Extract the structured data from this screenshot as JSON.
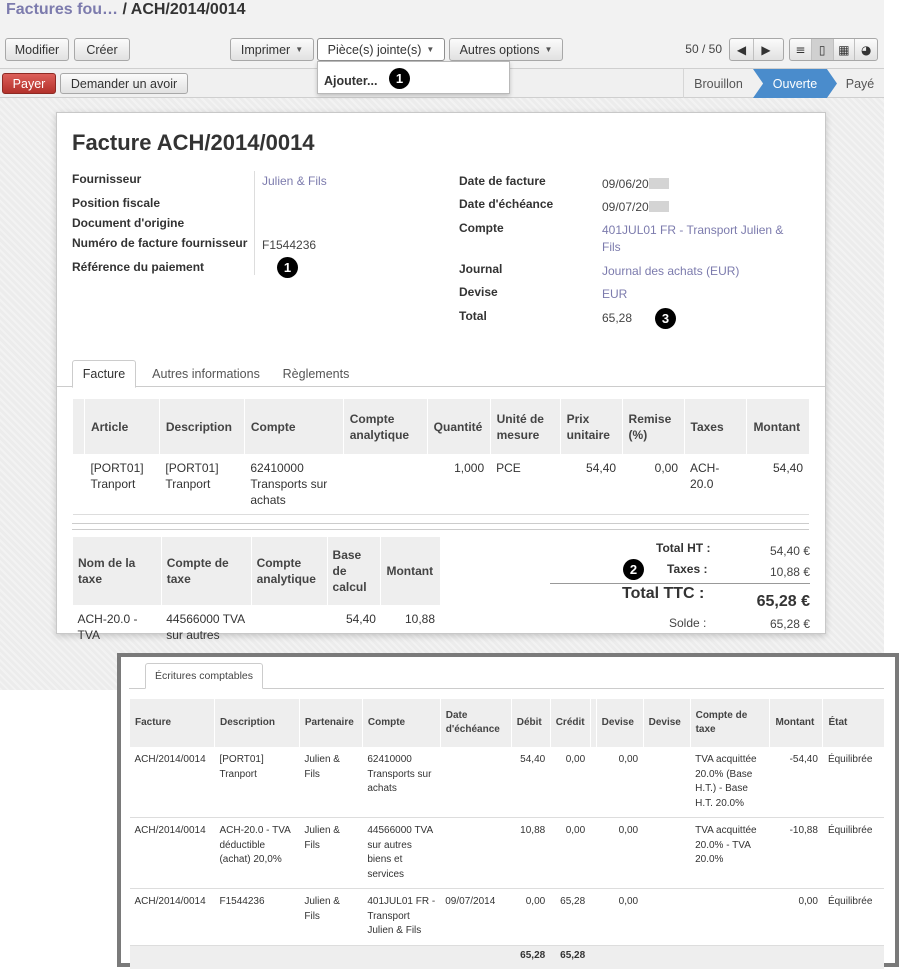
{
  "breadcrumb": {
    "parent": "Factures fou…",
    "separator": " / ",
    "current": "ACH/2014/0014"
  },
  "toolbar": {
    "modifier": "Modifier",
    "creer": "Créer",
    "imprimer": "Imprimer",
    "pieces_jointes": "Pièce(s) jointe(s)",
    "autres_options": "Autres options",
    "pager": "50 / 50",
    "prev_icon": "arrow-left-icon",
    "next_icon": "arrow-right-icon",
    "views": [
      "list-view-icon",
      "form-view-icon",
      "calendar-view-icon",
      "graph-view-icon"
    ]
  },
  "dropdown": {
    "item": "Ajouter..."
  },
  "callouts": {
    "one": "1",
    "two": "2",
    "three": "3"
  },
  "actions": {
    "payer": "Payer",
    "avoir": "Demander un avoir"
  },
  "status": {
    "steps": [
      "Brouillon",
      "Ouverte",
      "Payé"
    ],
    "active": "Ouverte"
  },
  "colors": {
    "pay_button": "#c0392b",
    "active_status": "#4a8ccc",
    "link": "#7c7bad"
  },
  "invoice": {
    "title": "Facture ACH/2014/0014",
    "left": {
      "fournisseur_label": "Fournisseur",
      "fournisseur": "Julien & Fils",
      "position_label": "Position fiscale",
      "origine_label": "Document d'origine",
      "num_fourn_label": "Numéro de facture fournisseur",
      "num_fourn": "F1544236",
      "ref_label": "Référence du paiement"
    },
    "right": {
      "date_label": "Date de facture",
      "date": "09/06/20",
      "echeance_label": "Date d'échéance",
      "echeance": "09/07/20",
      "compte_label": "Compte",
      "compte_line1": "401JUL01 FR - Transport Julien &",
      "compte_line2": "Fils",
      "journal_label": "Journal",
      "journal": "Journal des achats (EUR)",
      "devise_label": "Devise",
      "devise": "EUR",
      "total_label": "Total",
      "total": "65,28"
    }
  },
  "tabs": [
    "Facture",
    "Autres informations",
    "Règlements"
  ],
  "lines": {
    "headers": [
      "Article",
      "Description",
      "Compte",
      "Compte analytique",
      "Quantité",
      "Unité de mesure",
      "Prix unitaire",
      "Remise (%)",
      "Taxes",
      "Montant"
    ],
    "rows": [
      {
        "article": "[PORT01] Tranport",
        "description": "[PORT01] Tranport",
        "compte": "62410000 Transports sur achats",
        "analytique": "",
        "quantite": "1,000",
        "unite": "PCE",
        "prix": "54,40",
        "remise": "0,00",
        "taxes": "ACH-20.0",
        "montant": "54,40"
      }
    ]
  },
  "taxes": {
    "headers": [
      "Nom de la taxe",
      "Compte de taxe",
      "Compte analytique",
      "Base de calcul",
      "Montant"
    ],
    "rows": [
      {
        "nom": "ACH-20.0 - TVA",
        "compte": "44566000 TVA sur autres",
        "analytique": "",
        "base": "54,40",
        "montant": "10,88"
      }
    ]
  },
  "totals": {
    "ht_label": "Total HT :",
    "ht": "54,40 €",
    "taxes_label": "Taxes :",
    "taxes": "10,88 €",
    "ttc_label": "Total TTC :",
    "ttc": "65,28 €",
    "solde_label": "Solde :",
    "solde": "65,28 €"
  },
  "journal_panel": {
    "tab": "Écritures comptables",
    "headers": [
      "Facture",
      "Description",
      "Partenaire",
      "Compte",
      "Date d'échéance",
      "Débit",
      "Crédit",
      "",
      "Devise",
      "Devise",
      "Compte de taxe",
      "Montant",
      "État"
    ],
    "rows": [
      {
        "facture": "ACH/2014/0014",
        "description": "[PORT01] Tranport",
        "partenaire": "Julien & Fils",
        "compte": "62410000 Transports sur achats",
        "echeance": "",
        "debit": "54,40",
        "credit": "0,00",
        "devise1": "0,00",
        "devise2": "",
        "compte_taxe": "TVA acquittée 20.0% (Base H.T.) - Base H.T. 20.0%",
        "montant": "-54,40",
        "etat": "Équilibrée"
      },
      {
        "facture": "ACH/2014/0014",
        "description": "ACH-20.0 - TVA déductible (achat) 20,0%",
        "partenaire": "Julien & Fils",
        "compte": "44566000 TVA sur autres biens et services",
        "echeance": "",
        "debit": "10,88",
        "credit": "0,00",
        "devise1": "0,00",
        "devise2": "",
        "compte_taxe": "TVA acquittée 20.0% - TVA 20.0%",
        "montant": "-10,88",
        "etat": "Équilibrée"
      },
      {
        "facture": "ACH/2014/0014",
        "description": "F1544236",
        "partenaire": "Julien & Fils",
        "compte": "401JUL01 FR - Transport Julien & Fils",
        "echeance": "09/07/2014",
        "debit": "0,00",
        "credit": "65,28",
        "devise1": "0,00",
        "devise2": "",
        "compte_taxe": "",
        "montant": "0,00",
        "etat": "Équilibrée"
      }
    ],
    "footer": {
      "debit": "65,28",
      "credit": "65,28"
    }
  }
}
